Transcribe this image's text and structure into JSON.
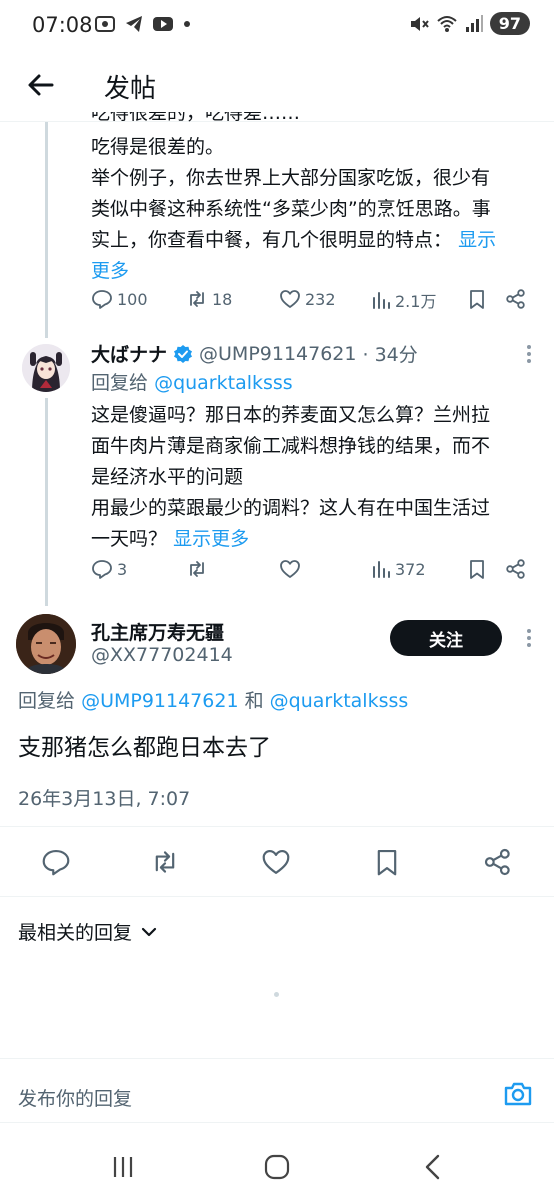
{
  "status_bar": {
    "time": "07:08",
    "battery": "97",
    "left_icons": [
      "screen-record-icon",
      "telegram-icon",
      "youtube-icon",
      "dot-icon"
    ],
    "right_icons": [
      "mute-icon",
      "wifi-icon",
      "signal-icon"
    ]
  },
  "header": {
    "title": "发帖",
    "back_icon": "arrow-left-icon"
  },
  "tweet1": {
    "partial_line": "吃得很差的，吃得差……",
    "lines": [
      "吃得是很差的。",
      "举个例子，你去世界上大部分国家吃饭，很少有",
      "类似中餐这种系统性“多菜少肉”的烹饪思路。事",
      "实上，你查看中餐，有几个很明显的特点："
    ],
    "show_more": "显示",
    "show_more_2": "更多",
    "stats": {
      "replies": "100",
      "retweets": "18",
      "likes": "232",
      "views": "2.1万"
    }
  },
  "tweet2": {
    "name": "大ばナナ",
    "verified": true,
    "handle": "@UMP91147621",
    "time": "· 34分",
    "reply_prefix": "回复给",
    "reply_to": "@quarktalksss",
    "lines": [
      "这是傻逼吗？那日本的荞麦面又怎么算？兰州拉",
      "面牛肉片薄是商家偷工减料想挣钱的结果，而不",
      "是经济水平的问题",
      "用最少的菜跟最少的调料？这人有在中国生活过"
    ],
    "last_line": "一天吗？",
    "show_more": "显示更多",
    "stats": {
      "replies": "3",
      "retweets": "",
      "likes": "",
      "views": "372"
    }
  },
  "tweet3": {
    "name": "孔主席万寿无疆",
    "handle": "@XX77702414",
    "follow_label": "关注",
    "reply_prefix": "回复给",
    "reply_to_1": "@UMP91147621",
    "reply_and": "和",
    "reply_to_2": "@quarktalksss",
    "text": "支那猪怎么都跑日本去了",
    "timestamp": "26年3月13日, 7:07"
  },
  "sort": {
    "label": "最相关的回复"
  },
  "reply_bar": {
    "placeholder": "发布你的回复"
  },
  "colors": {
    "link": "#1d9bf0",
    "secondary": "#536471",
    "text": "#0f1419",
    "follow_bg": "#0f1419"
  }
}
